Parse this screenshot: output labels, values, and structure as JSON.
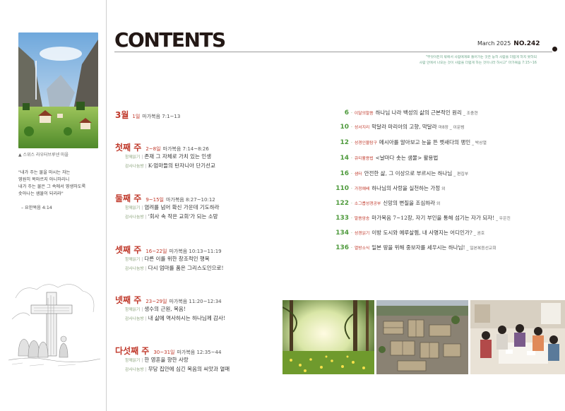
{
  "header": {
    "title": "CONTENTS",
    "issue_date": "March 2025",
    "issue_no": "NO.242",
    "epigraph_line1": "\"무엇이든지 밖에서 사람에게로 들어가는 것은 능히 사람을 더럽게 하지 못하되",
    "epigraph_line2": "사람 안에서 나오는 것이 사람을 더럽게 하는 것이니라 하시고\" 마가복음 7:15~16"
  },
  "sidebar": {
    "photo_caption": "▲ 스위스 라우터브루넨 마을",
    "quote_lines": [
      "\"내가 주는 물을 마시는 자는",
      "영원히 목마르지 아니하리니",
      "내가 주는 물은 그 속에서 영생하도록",
      "솟아나는 샘물이 되리라\""
    ],
    "quote_source": "– 요한복음 4:14"
  },
  "month": {
    "label": "3월",
    "sub": "1일",
    "ref": "마가복음 7:1~13"
  },
  "weeks": [
    {
      "label": "첫째 주",
      "range": "2~8일",
      "ref": "마가복음 7:14~8:26",
      "lines": [
        {
          "tag": "함께읽기",
          "text": "존재 그 자체로 가치 있는 인생"
        },
        {
          "tag": "감사나눔방",
          "text": "K-엄마들의 탄자니아 단기선교"
        }
      ]
    },
    {
      "label": "둘째 주",
      "range": "9~15일",
      "ref": "마가복음 8:27~10:12",
      "lines": [
        {
          "tag": "함께읽기",
          "text": "염려를 넘어 확신 가운데 기도하라"
        },
        {
          "tag": "감사나눔방",
          "text": "'회사 속 작은 교회'가 되는 소망"
        }
      ]
    },
    {
      "label": "셋째 주",
      "range": "16~22일",
      "ref": "마가복음 10:13~11:19",
      "lines": [
        {
          "tag": "함께읽기",
          "text": "다른 이를 위한 창조적인 행복"
        },
        {
          "tag": "감사나눔방",
          "text": "다시 엄마를 품은 그리스도인으로!"
        }
      ]
    },
    {
      "label": "넷째 주",
      "range": "23~29일",
      "ref": "마가복음 11:20~12:34",
      "lines": [
        {
          "tag": "함께읽기",
          "text": "생수의 근원, 복음!"
        },
        {
          "tag": "감사나눔방",
          "text": "내 삶에 역사하시는 하나님께 감사!"
        }
      ]
    },
    {
      "label": "다섯째 주",
      "range": "30~31일",
      "ref": "마가복음 12:35~44",
      "lines": [
        {
          "tag": "함께읽기",
          "text": "한 영혼을 향한 사랑"
        },
        {
          "tag": "감사나눔방",
          "text": "무당 집안에 심긴 복음의 씨앗과 열매"
        }
      ]
    }
  ],
  "articles": [
    {
      "page": "6",
      "category": "이달의말씀",
      "title": "하나님 나라 백성의 삶의 근본적인 원리",
      "author": "_ 조충현"
    },
    {
      "page": "10",
      "category": "성서지리",
      "title": "막달라 마리아의 고향, 막달라",
      "author": "마8장 _ 이문범"
    },
    {
      "page": "12",
      "category": "성경인물탐구",
      "title": "메시아를 알아보고 눈을 뜬 벳새다의 맹인",
      "author": "_ 박상열"
    },
    {
      "page": "14",
      "category": "큐티활용법",
      "title": "<날마다 솟는 샘물> 활용법",
      "author": ""
    },
    {
      "page": "16",
      "category": "샘터",
      "title": "안전한 삶, 그 이상으로 부르시는 하나님",
      "author": "_ 편집부"
    },
    {
      "page": "110",
      "category": "가정예배",
      "title": "하나님의 사랑을 실천하는 가정",
      "author": "외"
    },
    {
      "page": "122",
      "category": "소그룹성경공부",
      "title": "신앙의 변질을 조심하라",
      "author": "외"
    },
    {
      "page": "133",
      "category": "말씀암송",
      "title": "마가복음 7~12장, 자기 부인을 통해 섬기는 자가 되자!",
      "author": "_ 우은진"
    },
    {
      "page": "134",
      "category": "성경읽기",
      "title": "이방 도시와 예루살렘, 내 사명지는 어디인가?",
      "author": "_ 권호"
    },
    {
      "page": "136",
      "category": "열방소식",
      "title": "일본 땅을 위해 중보자를 세우시는 하나님!",
      "author": "_ 일본복음선교회"
    }
  ],
  "colors": {
    "accent_red": "#c0392b",
    "accent_green": "#4e9a3c",
    "tag_green": "#8aa27a"
  }
}
